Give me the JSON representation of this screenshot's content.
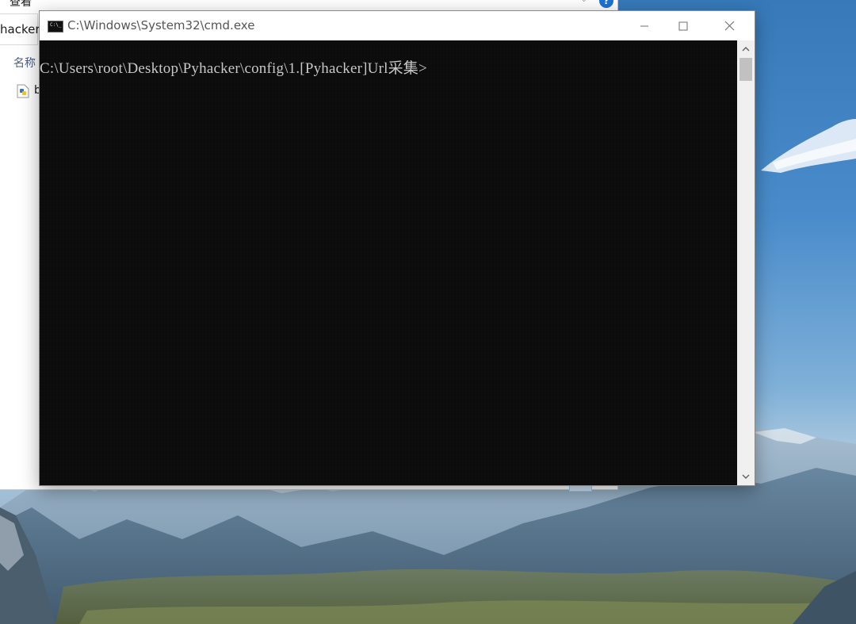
{
  "explorer": {
    "menu_label": "查看",
    "path_fragment": "hacker",
    "column_header": "名称",
    "file_name_fragment": "b",
    "help_label": "?"
  },
  "cmd": {
    "title": "C:\\Windows\\System32\\cmd.exe",
    "prompt": "C:\\Users\\root\\Desktop\\Pyhacker\\config\\1.[Pyhacker]Url采集>",
    "icons": {
      "app": "cmd-app-icon",
      "minimize": "minimize-icon",
      "maximize": "maximize-icon",
      "close": "close-icon",
      "scroll_up": "chevron-up-icon",
      "scroll_down": "chevron-down-icon"
    }
  },
  "colors": {
    "console_bg": "#0c0c0c",
    "console_text": "#c8c8c8",
    "titlebar_bg": "#ffffff",
    "accent": "#1c73d6"
  }
}
